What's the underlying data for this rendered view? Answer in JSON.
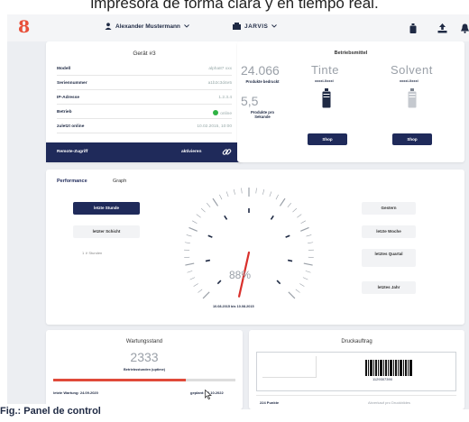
{
  "caption_top": "impresora de forma clara y en tiempo real.",
  "caption_bottom": "Fig.: Panel de control",
  "topbar": {
    "logo": "8",
    "user_name": "Alexander Mustermann",
    "app_name": "JARVIS"
  },
  "device": {
    "title": "Gerät #3",
    "rows": [
      {
        "key": "Modell",
        "value": "alpha87 xxx"
      },
      {
        "key": "Seriennummer",
        "value": "a1b2c3d4e5"
      },
      {
        "key": "IP-Adresse",
        "value": "1.2.3.4"
      },
      {
        "key": "Betrieb",
        "value": "online"
      },
      {
        "key": "zuletzt online",
        "value": "10.02.2015, 10:00"
      }
    ],
    "remote_key": "Remote-Zugriff",
    "remote_value": "aktivieren"
  },
  "supplies": {
    "title": "Betriebsmittel",
    "printed_value": "24.066",
    "printed_label": "Produkte bedruckt",
    "per_second_value": "5,5",
    "per_second_label": "Produkte pro Sekunde",
    "ink_label": "Tinte",
    "ink_sub": "xxxxl-Xxxxl",
    "solvent_label": "Solvent",
    "solvent_sub": "xxxxl-Xxxxl",
    "shop_label": "Shop"
  },
  "performance": {
    "tabs": [
      "Performance",
      "Graph"
    ],
    "left_buttons": [
      "letzte Stunde",
      "letzter Schicht"
    ],
    "selector": "1  ∨  Stunden",
    "right_buttons": [
      "Gestern",
      "letzte Woche",
      "letztes Quartal",
      "letztes Jahr"
    ],
    "gauge_percent": 88,
    "gauge_label": "88%",
    "date_range": "10.08.2015 bis 10.08.2015"
  },
  "maintenance": {
    "title": "Wartungsstand",
    "hours": "2333",
    "hours_label": "Betriebsstunden (uptime)",
    "progress": 0.73,
    "last_label": "letzte Wartung: 24.09.2020",
    "planned_label": "geplant: 18.10.2022"
  },
  "print_job": {
    "title": "Druckauftrag",
    "barcode_number": "1129307390",
    "points_label": "224 Punkte",
    "points_value": "Abverkauf pro Druckbildes"
  },
  "colors": {
    "accent": "#1f2a5a",
    "alert": "#e04a3a",
    "online": "#2fb344"
  }
}
